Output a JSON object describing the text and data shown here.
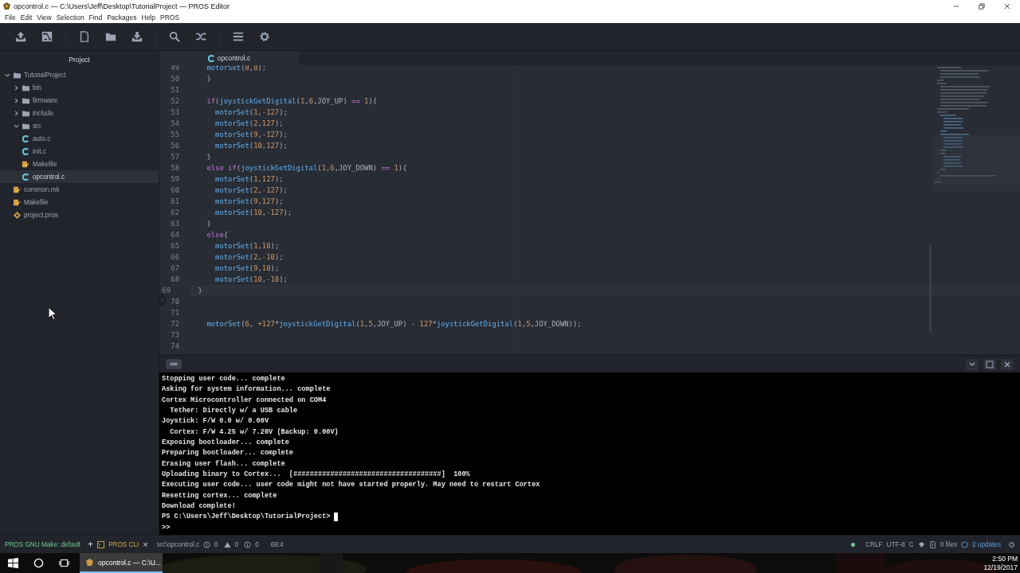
{
  "window": {
    "title": "opcontrol.c — C:\\Users\\Jeff\\Desktop\\TutorialProject — PROS Editor"
  },
  "menu": [
    "File",
    "Edit",
    "View",
    "Selection",
    "Find",
    "Packages",
    "Help",
    "PROS"
  ],
  "tree": {
    "title": "Project",
    "items": [
      {
        "label": "TutorialProject",
        "kind": "folder",
        "expanded": true,
        "selected": false,
        "children": [
          {
            "label": "bin",
            "kind": "folder",
            "expanded": false,
            "selected": false
          },
          {
            "label": "firmware",
            "kind": "folder",
            "expanded": false,
            "selected": false
          },
          {
            "label": "include",
            "kind": "folder",
            "expanded": false,
            "selected": false
          },
          {
            "label": "src",
            "kind": "folder",
            "expanded": true,
            "selected": false,
            "children": [
              {
                "label": "auto.c",
                "kind": "c",
                "selected": false
              },
              {
                "label": "init.c",
                "kind": "c",
                "selected": false
              },
              {
                "label": "Makefile",
                "kind": "make",
                "selected": false
              },
              {
                "label": "opcontrol.c",
                "kind": "c",
                "selected": true
              }
            ]
          },
          {
            "label": "common.mk",
            "kind": "make",
            "selected": false
          },
          {
            "label": "Makefile",
            "kind": "make",
            "selected": false
          },
          {
            "label": "project.pros",
            "kind": "pros",
            "selected": false
          }
        ]
      }
    ]
  },
  "editor": {
    "tab": "opcontrol.c",
    "lines": [
      {
        "number": "49",
        "text": "    motorSet(8,0);",
        "current": false
      },
      {
        "number": "50",
        "text": "    }",
        "current": false
      },
      {
        "number": "51",
        "current": false
      },
      {
        "number": "52",
        "text": "    if(joystickGetDigital(1,6,JOY_UP) == 1){",
        "current": false
      },
      {
        "number": "53",
        "text": "      motorSet(1,-127);",
        "current": false
      },
      {
        "number": "54",
        "text": "      motorSet(2,127);",
        "current": false
      },
      {
        "number": "55",
        "text": "      motorSet(9,-127);",
        "current": false
      },
      {
        "number": "56",
        "text": "      motorSet(10,127);",
        "current": false
      },
      {
        "number": "57",
        "text": "    }",
        "current": false
      },
      {
        "number": "58",
        "text": "    else if(joystickGetDigital(1,6,JOY_DOWN) == 1){",
        "current": false
      },
      {
        "number": "59",
        "text": "      motorSet(1,127);",
        "current": false
      },
      {
        "number": "60",
        "text": "      motorSet(2,-127);",
        "current": false
      },
      {
        "number": "61",
        "text": "      motorSet(9,127);",
        "current": false
      },
      {
        "number": "62",
        "text": "      motorSet(10,-127);",
        "current": false
      },
      {
        "number": "63",
        "text": "    }",
        "current": false
      },
      {
        "number": "64",
        "text": "    else{",
        "current": false
      },
      {
        "number": "65",
        "text": "      motorSet(1,10);",
        "current": false
      },
      {
        "number": "66",
        "text": "      motorSet(2,-10);",
        "current": false
      },
      {
        "number": "67",
        "text": "      motorSet(9,10);",
        "current": false
      },
      {
        "number": "68",
        "text": "      motorSet(10,-10);",
        "current": false
      },
      {
        "number": "69",
        "text": "    }",
        "current": true
      },
      {
        "number": "70",
        "current": false
      },
      {
        "number": "71",
        "current": false
      },
      {
        "number": "72",
        "text": "    motorSet(6, +127*joystickGetDigital(1,5,JOY_UP) - 127*joystickGetDigital(1,5,JOY_DOWN));",
        "current": false
      },
      {
        "number": "73",
        "current": false
      },
      {
        "number": "74",
        "current": false
      }
    ]
  },
  "terminal": {
    "lines": [
      "Stopping user code... complete",
      "Asking for system information... complete",
      "Cortex Microcontroller connected on COM4",
      "  Tether: Directly w/ a USB cable",
      "Joystick: F/W 0.0 w/ 0.00V",
      "  Cortex: F/W 4.25 w/ 7.20V (Backup: 0.00V)",
      "Exposing bootloader... complete",
      "Preparing bootloader... complete",
      "Erasing user flash... complete",
      "Uploading binary to Cortex...  [####################################]  100%",
      "Executing user code... user code might not have started properly. May need to restart Cortex",
      "Resetting cortex... complete",
      "Download complete!"
    ],
    "prompt": "PS C:\\Users\\Jeff\\Desktop\\TutorialProject>",
    "continuation": ">>"
  },
  "status_bar": {
    "build": "PROS GNU Make: default",
    "add": "+",
    "terminal_tab": "PROS CLI",
    "close": "×",
    "file": "src\\opcontrol.c",
    "errors": "0",
    "warnings": "0",
    "infos": "0",
    "cursor": "69:4",
    "line_ending": "CRLF",
    "encoding": "UTF-8",
    "grammar": "C",
    "files": "0 files",
    "updates": "2 updates"
  },
  "taskbar": {
    "app": "opcontrol.c — C:\\U...",
    "time": "2:50 PM",
    "date": "12/19/2017"
  }
}
